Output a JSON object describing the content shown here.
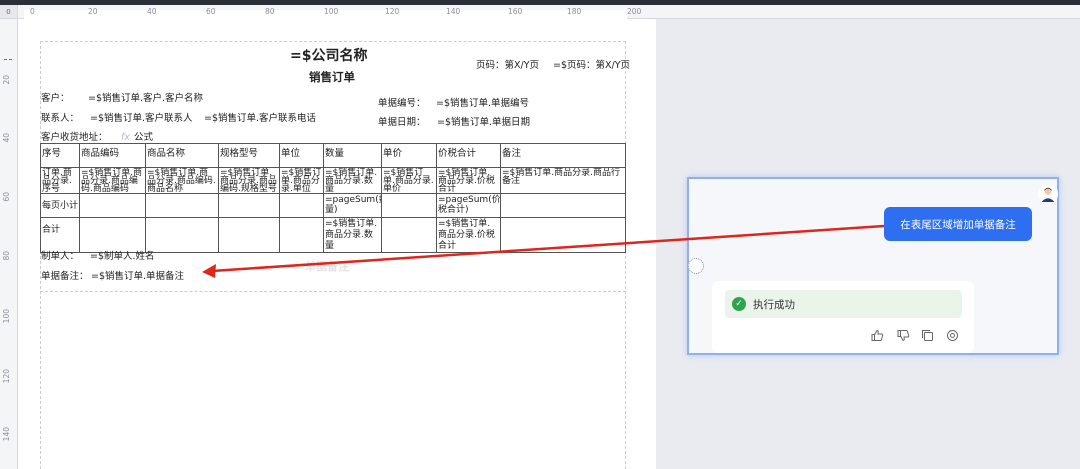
{
  "rulers": {
    "corner": "0",
    "top": [
      "0",
      "20",
      "40",
      "60",
      "80",
      "100",
      "120",
      "140",
      "160",
      "180",
      "200"
    ],
    "left": [
      "20",
      "40",
      "60",
      "80",
      "100",
      "120",
      "140"
    ]
  },
  "report": {
    "company": "=$公司名称",
    "title": "销售订单",
    "page_no": "页码：第X/Y页",
    "page_no_expr": "=$页码：第X/Y页",
    "customer_label": "客户：",
    "customer_value": "=$销售订单.客户.客户名称",
    "bill_no_label": "单据编号：",
    "bill_no_value": "=$销售订单.单据编号",
    "contact_label": "联系人：",
    "contact_value": "=$销售订单.客户联系人",
    "contact_phone": "=$销售订单.客户联系电话",
    "bill_date_label": "单据日期：",
    "bill_date_value": "=$销售订单.单据日期",
    "address_label": "客户收货地址：",
    "formula_icon": "fx",
    "address_value": "公式",
    "columns": [
      "序号",
      "商品编码",
      "商品名称",
      "规格型号",
      "单位",
      "数量",
      "单价",
      "价税合计",
      "备注"
    ],
    "row_detail": [
      "订单.商品分录.序号",
      "=$销售订单.商品分录.商品编码.商品编码",
      "=$销售订单.商品分录.商品编码.商品名称",
      "=$销售订单.商品分录.商品编码.规格型号",
      "=$销售订单.商品分录.单位",
      "=$销售订单.商品分录.数量",
      "=$销售订单.商品分录.单价",
      "=$销售订单.商品分录.价税合计",
      "=$销售订单.商品分录.商品行备注"
    ],
    "row_page_subtotal": [
      "每页小计",
      "",
      "",
      "",
      "",
      "=pageSum(数量)",
      "",
      "=pageSum(价税合计)",
      ""
    ],
    "row_total": [
      "合计",
      "",
      "",
      "",
      "",
      "=$销售订单.商品分录.数量",
      "",
      "=$销售订单.商品分录.价税合计",
      ""
    ],
    "maker_label": "制单人：",
    "maker_value": "=$制单人.姓名",
    "note_label": "单据备注：",
    "note_value": "=$销售订单.单据备注",
    "watermark": "单据备注"
  },
  "chat": {
    "user_message": "在表尾区域增加单据备注",
    "result": "执行成功",
    "actions": [
      "thumbs-up-icon",
      "thumbs-down-icon",
      "copy-icon",
      "refresh-icon"
    ]
  },
  "colors": {
    "accent": "#2e6ff2",
    "arrow": "#e0251b",
    "success": "#2ea44f"
  }
}
